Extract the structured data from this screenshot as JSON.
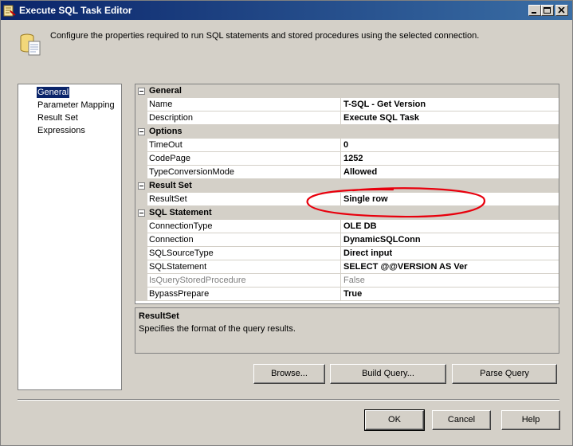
{
  "window": {
    "title": "Execute SQL Task Editor",
    "title_icon": "sql-task-icon",
    "controls": [
      "minimize-icon",
      "maximize-icon",
      "close-icon"
    ]
  },
  "header": {
    "icon": "database-script-icon",
    "text": "Configure the properties required to run SQL statements and stored procedures using the selected connection."
  },
  "nav": {
    "items": [
      {
        "label": "General",
        "selected": true
      },
      {
        "label": "Parameter Mapping",
        "selected": false
      },
      {
        "label": "Result Set",
        "selected": false
      },
      {
        "label": "Expressions",
        "selected": false
      }
    ]
  },
  "grid": {
    "categories": [
      {
        "name": "General",
        "props": [
          {
            "name": "Name",
            "value": "T-SQL - Get Version"
          },
          {
            "name": "Description",
            "value": "Execute SQL Task"
          }
        ]
      },
      {
        "name": "Options",
        "props": [
          {
            "name": "TimeOut",
            "value": "0"
          },
          {
            "name": "CodePage",
            "value": "1252"
          },
          {
            "name": "TypeConversionMode",
            "value": "Allowed"
          }
        ]
      },
      {
        "name": "Result Set",
        "props": [
          {
            "name": "ResultSet",
            "value": "Single row"
          }
        ]
      },
      {
        "name": "SQL Statement",
        "props": [
          {
            "name": "ConnectionType",
            "value": "OLE DB"
          },
          {
            "name": "Connection",
            "value": "DynamicSQLConn"
          },
          {
            "name": "SQLSourceType",
            "value": "Direct input"
          },
          {
            "name": "SQLStatement",
            "value": "SELECT @@VERSION AS Ver"
          },
          {
            "name": "IsQueryStoredProcedure",
            "value": "False",
            "disabled": true
          },
          {
            "name": "BypassPrepare",
            "value": "True"
          }
        ]
      }
    ],
    "annotation_color": "#e8000d"
  },
  "description": {
    "title": "ResultSet",
    "text": "Specifies the format of the query results."
  },
  "actions": {
    "browse": "Browse...",
    "build_query": "Build Query...",
    "parse_query": "Parse Query"
  },
  "footer": {
    "ok": "OK",
    "cancel": "Cancel",
    "help": "Help"
  },
  "colors": {
    "titlebar": "#0a246a",
    "dialog_bg": "#d4d0c8",
    "selection": "#0a246a"
  }
}
